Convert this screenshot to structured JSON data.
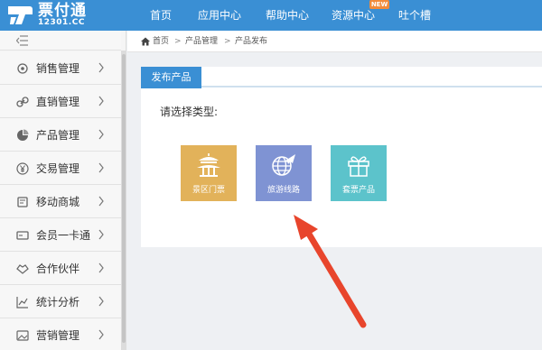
{
  "brand": {
    "name": "票付通",
    "domain": "12301.CC"
  },
  "nav": {
    "items": [
      "首页",
      "应用中心",
      "帮助中心",
      "资源中心",
      "吐个槽"
    ],
    "badge": "NEW"
  },
  "sidebar": {
    "items": [
      {
        "label": "销售管理",
        "icon": "settings-icon"
      },
      {
        "label": "直销管理",
        "icon": "link-icon"
      },
      {
        "label": "产品管理",
        "icon": "pie-chart-icon"
      },
      {
        "label": "交易管理",
        "icon": "yen-coin-icon"
      },
      {
        "label": "移动商城",
        "icon": "mobile-icon"
      },
      {
        "label": "会员一卡通",
        "icon": "card-icon"
      },
      {
        "label": "合作伙伴",
        "icon": "handshake-icon"
      },
      {
        "label": "统计分析",
        "icon": "line-chart-icon"
      },
      {
        "label": "营销管理",
        "icon": "image-icon"
      }
    ]
  },
  "breadcrumb": [
    "首页",
    "产品管理",
    "产品发布"
  ],
  "panel": {
    "tab": "发布产品",
    "prompt": "请选择类型:",
    "tiles": [
      {
        "label": "景区门票",
        "icon": "pavilion-icon",
        "color": "#e2b25a"
      },
      {
        "label": "旅游线路",
        "icon": "globe-plane-icon",
        "color": "#7f93d3"
      },
      {
        "label": "套票产品",
        "icon": "gift-icon",
        "color": "#5cc3cb"
      }
    ]
  },
  "colors": {
    "accent": "#3a8fd4",
    "annotation": "#e8452c"
  }
}
